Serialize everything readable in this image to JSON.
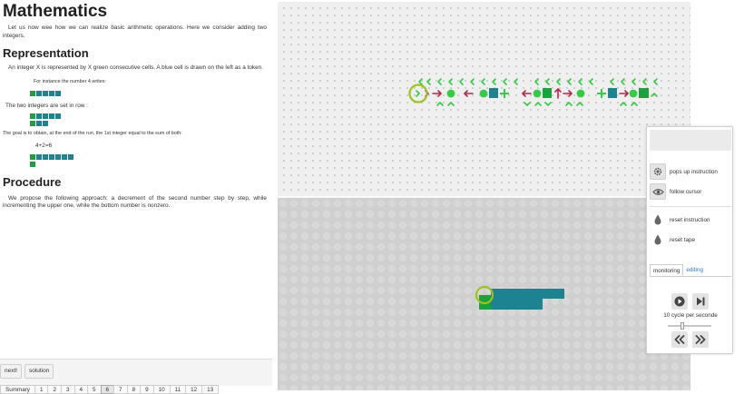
{
  "doc": {
    "title": "Mathematics",
    "intro": "Let us now wee how we can realize basic arithmetic operations. Here we consider adding two integers.",
    "sections": {
      "representation": {
        "heading": "Representation",
        "p1": "An integer X is represented by X green consecutive cells. A blue cell is drawn on the left as a token.",
        "example_caption": "For instance the number 4 writes:",
        "p2": "The two integers are set in row :",
        "p3": "The goal is to obtain, at the end of the run, the 1st integer equal to the sum of both:",
        "equation": "4+2=6"
      },
      "procedure": {
        "heading": "Procedure",
        "p1": "We propose the following approach: a decrement of the second number step by step, while incrementing the upper one, while the bottom number is nonzero."
      }
    }
  },
  "buttons": {
    "next": "next!",
    "solution": "solution"
  },
  "pager": {
    "items": [
      "Summary",
      "1",
      "2",
      "3",
      "4",
      "5",
      "6",
      "7",
      "8",
      "9",
      "10",
      "11",
      "12",
      "13"
    ],
    "active": "6"
  },
  "panel": {
    "pops_up": "pops up instruction",
    "follow": "follow cursor",
    "reset_instruction": "reset instruction",
    "reset_tape": "reset tape",
    "tab_monitoring": "monitoring",
    "tab_editing": "editing",
    "speed": "10 cycle per seconde",
    "speed_value": 10
  },
  "colors": {
    "green": "#1aa33b",
    "teal": "#1d8391",
    "bright_green": "#33cc44",
    "red": "#b3294e",
    "cursor": "#9bc31c",
    "link": "#2a7ac8"
  },
  "icons": [
    "gear-icon",
    "eye-icon",
    "drop-icon",
    "play-icon",
    "step-icon",
    "rewind-icon",
    "fast-forward-icon"
  ]
}
